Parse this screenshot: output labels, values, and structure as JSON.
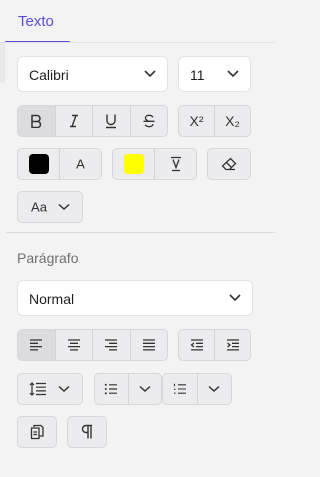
{
  "tabs": {
    "active_label": "Texto"
  },
  "font": {
    "family_value": "Calibri",
    "size_value": "11",
    "superscript_label": "X²",
    "subscript_label": "X₂",
    "font_color_label": "A",
    "font_color": "#000000",
    "highlight_color": "#ffff00",
    "case_label": "Aa"
  },
  "paragraph": {
    "section_title": "Parágrafo",
    "style_value": "Normal"
  },
  "colors": {
    "accent": "#5b4fcf",
    "panel_bg": "#f3f3f4",
    "button_bg": "#ececee"
  }
}
